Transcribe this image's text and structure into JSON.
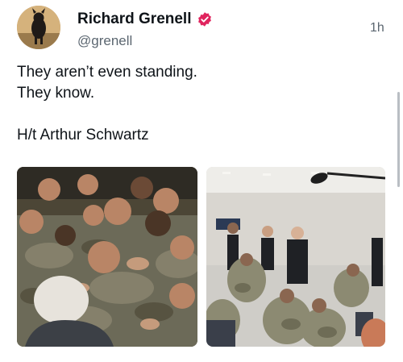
{
  "tweet": {
    "display_name": "Richard Grenell",
    "handle": "@grenell",
    "timestamp": "1h",
    "verified_color": "#e0245e",
    "text_lines": [
      "They aren’t even standing.",
      "They know.",
      "",
      "H/t Arthur Schwartz"
    ]
  },
  "media": [
    {
      "name": "photo-troops-crowd",
      "icon": "photo"
    },
    {
      "name": "photo-troops-seated",
      "icon": "photo"
    }
  ]
}
